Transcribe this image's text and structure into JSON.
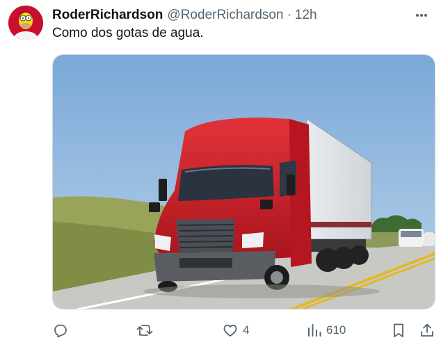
{
  "tweet": {
    "display_name": "RoderRichardson",
    "handle": "@RoderRichardson",
    "separator": "·",
    "time": "12h",
    "text": "Como dos gotas de agua.",
    "more_icon": "more-horizontal-icon",
    "media": {
      "subject": "red semi-truck with white trailer on highway",
      "colors": {
        "sky": "#8fb6dc",
        "truck": "#d3202a",
        "road": "#c9c9c4",
        "grass": "#9aa35a"
      }
    }
  },
  "actions": {
    "reply": {
      "icon": "reply-icon",
      "count": ""
    },
    "repost": {
      "icon": "repost-icon",
      "count": ""
    },
    "like": {
      "icon": "heart-icon",
      "count": "4"
    },
    "views": {
      "icon": "views-icon",
      "count": "610"
    },
    "bookmark": {
      "icon": "bookmark-icon"
    },
    "share": {
      "icon": "share-icon"
    }
  },
  "colors": {
    "text_primary": "#0f1419",
    "text_secondary": "#536471",
    "border": "#cfd9de"
  }
}
